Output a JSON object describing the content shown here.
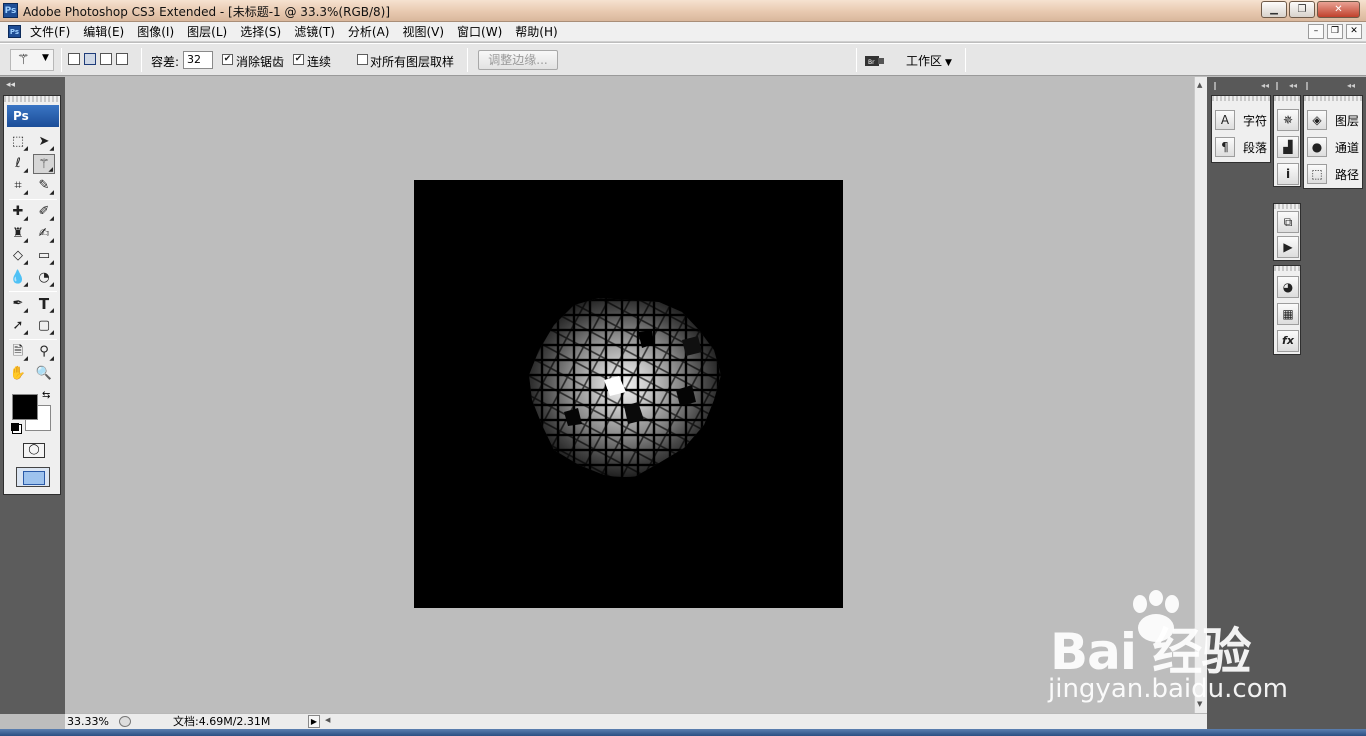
{
  "window": {
    "app_icon": "Ps",
    "title": "Adobe Photoshop CS3 Extended - [未标题-1 @ 33.3%(RGB/8)]",
    "controls": {
      "minimize": "▁",
      "maximize": "❐",
      "close": "✕"
    }
  },
  "menubar": {
    "doc_icon": "Ps",
    "items": [
      "文件(F)",
      "编辑(E)",
      "图像(I)",
      "图层(L)",
      "选择(S)",
      "滤镜(T)",
      "分析(A)",
      "视图(V)",
      "窗口(W)",
      "帮助(H)"
    ],
    "mdi_controls": {
      "minimize": "–",
      "restore": "❐",
      "close": "✕"
    }
  },
  "options": {
    "tool_icon": "magic-wand-icon",
    "tolerance_label": "容差:",
    "tolerance_value": "32",
    "anti_alias_label": "消除锯齿",
    "anti_alias_checked": true,
    "contiguous_label": "连续",
    "contiguous_checked": true,
    "sample_all_label": "对所有图层取样",
    "sample_all_checked": false,
    "refine_edge_label": "调整边缘...",
    "workspace_label": "工作区"
  },
  "toolbox": {
    "badge": "Ps",
    "type_tool": "T",
    "foreground_color": "#000000",
    "background_color": "#ffffff"
  },
  "canvas": {
    "background": "#000000",
    "filter_effect": "stained-glass cells, bright center fading to dark edges"
  },
  "status": {
    "zoom": "33.33%",
    "doc_info": "文档:4.69M/2.31M"
  },
  "panels": {
    "group1": [
      {
        "icon": "character-icon",
        "glyph": "A",
        "label": "字符"
      },
      {
        "icon": "paragraph-icon",
        "glyph": "¶",
        "label": "段落"
      }
    ],
    "group2": [
      {
        "icon": "navigator-icon",
        "glyph": "✵"
      },
      {
        "icon": "histogram-icon",
        "glyph": "▟"
      },
      {
        "icon": "info-icon",
        "glyph": "i"
      }
    ],
    "group3": [
      {
        "icon": "history-icon",
        "glyph": "⧉"
      },
      {
        "icon": "actions-icon",
        "glyph": "▶"
      }
    ],
    "group4": [
      {
        "icon": "color-icon",
        "glyph": "◕"
      },
      {
        "icon": "swatches-icon",
        "glyph": "▦"
      },
      {
        "icon": "styles-icon",
        "glyph": "fx"
      }
    ],
    "group5": [
      {
        "icon": "layers-icon",
        "glyph": "◈",
        "label": "图层"
      },
      {
        "icon": "channels-icon",
        "glyph": "●",
        "label": "通道"
      },
      {
        "icon": "paths-icon",
        "glyph": "⬚",
        "label": "路径"
      }
    ]
  },
  "watermark": {
    "brand": "Bai  经验",
    "url": "jingyan.baidu.com"
  }
}
